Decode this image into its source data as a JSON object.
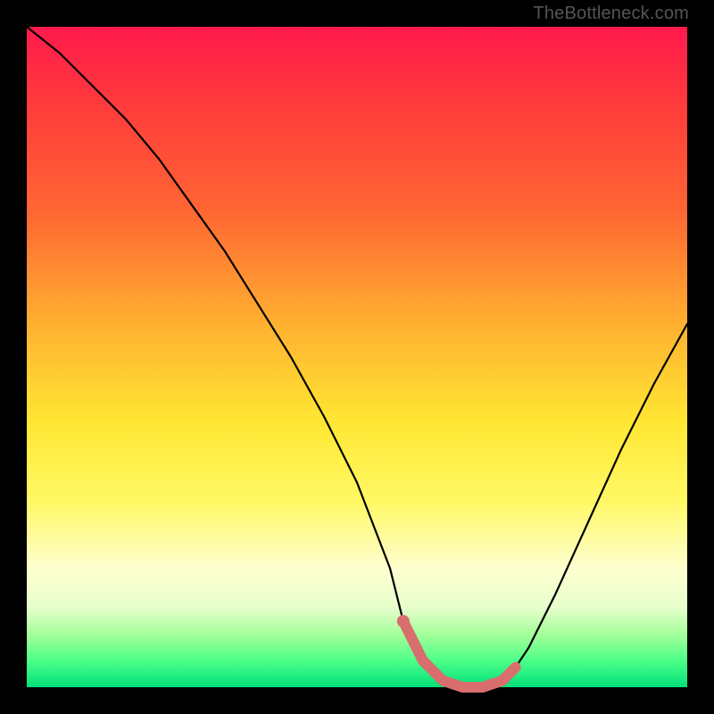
{
  "watermark": "TheBottleneck.com",
  "chart_data": {
    "type": "line",
    "title": "",
    "xlabel": "",
    "ylabel": "",
    "xlim": [
      0,
      100
    ],
    "ylim": [
      0,
      100
    ],
    "series": [
      {
        "name": "bottleneck-curve",
        "x": [
          0,
          5,
          10,
          15,
          20,
          25,
          30,
          35,
          40,
          45,
          50,
          55,
          57,
          60,
          63,
          66,
          69,
          72,
          74,
          76,
          80,
          85,
          90,
          95,
          100
        ],
        "y": [
          100,
          96,
          91,
          86,
          80,
          73,
          66,
          58,
          50,
          41,
          31,
          18,
          10,
          4,
          1,
          0,
          0,
          1,
          3,
          6,
          14,
          25,
          36,
          46,
          55
        ]
      },
      {
        "name": "highlight-band",
        "x": [
          57,
          60,
          63,
          66,
          69,
          72,
          74
        ],
        "y": [
          10,
          4,
          1,
          0,
          0,
          1,
          3
        ]
      }
    ],
    "marker": {
      "x": 57,
      "y": 10
    },
    "colors": {
      "curve": "#000000",
      "highlight": "#d86e6e",
      "marker": "#d86e6e"
    }
  }
}
